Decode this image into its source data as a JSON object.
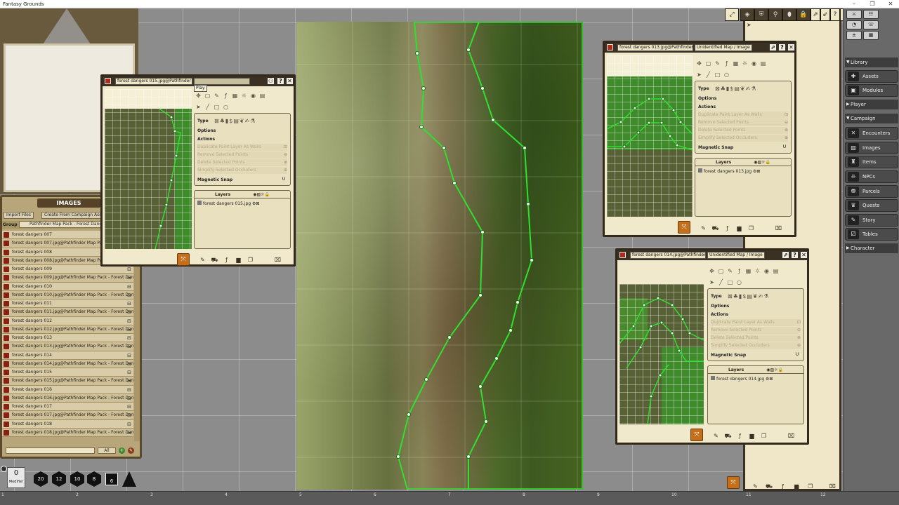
{
  "app": {
    "title": "Fantasy Grounds",
    "window_controls": [
      "–",
      "❐",
      "✕"
    ]
  },
  "images_panel": {
    "title": "IMAGES",
    "import_button": "Import Files",
    "create_button": "Create From Campaign Assets",
    "group_label": "Group",
    "group_value": "Pathfinder Map Pack - Forest Dangers.m",
    "filter_all": "All",
    "items": [
      "forest dangers 007",
      "forest dangers 007.jpg@Pathfinder Map Pack - Fo",
      "forest dangers 008",
      "forest dangers 008.jpg@Pathfinder Map Pack - Forest Dangers.m",
      "forest dangers 009",
      "forest dangers 009.jpg@Pathfinder Map Pack - Forest Dangers.m",
      "forest dangers 010",
      "forest dangers 010.jpg@Pathfinder Map Pack - Forest Dangers.m",
      "forest dangers 011",
      "forest dangers 011.jpg@Pathfinder Map Pack - Forest Dangers.m",
      "forest dangers 012",
      "forest dangers 012.jpg@Pathfinder Map Pack - Forest Dangers.m",
      "forest dangers 013",
      "forest dangers 013.jpg@Pathfinder Map Pack - Forest Dangers.m",
      "forest dangers 014",
      "forest dangers 014.jpg@Pathfinder Map Pack - Forest Dangers.m",
      "forest dangers 015",
      "forest dangers 015.jpg@Pathfinder Map Pack - Forest Dangers.m",
      "forest dangers 016",
      "forest dangers 016.jpg@Pathfinder Map Pack - Forest Dangers.m",
      "forest dangers 017",
      "forest dangers 017.jpg@Pathfinder Map Pack - Forest Dangers.m",
      "forest dangers 018",
      "forest dangers 018.jpg@Pathfinder Map Pack - Forest Dangers.m"
    ]
  },
  "windows": {
    "w15": {
      "tab1": "forest dangers 015.jpg@Pathfinder M",
      "tooltip": "Play",
      "layer": "forest dangers 015.jpg"
    },
    "w13": {
      "tab1": "forest dangers 013.jpg@Pathfinder M",
      "tab2": "Unidentified Map / Image",
      "layer": "forest dangers 013.jpg"
    },
    "w14": {
      "tab1": "forest dangers 014.jpg@Pathfinder M",
      "tab2": "Unidentified Map / Image",
      "layer": "forest dangers 014.jpg"
    }
  },
  "tools": {
    "type": "Type",
    "options": "Options",
    "actions": "Actions",
    "duplicate": "Duplicate Paint Layer As Walls",
    "remove": "Remove Selected Points",
    "delete": "Delete Selected Points",
    "simplify": "Simplify Selected Occluders",
    "magnetic": "Magnetic Snap",
    "layers": "Layers"
  },
  "sidebar": {
    "library": "Library",
    "assets": "Assets",
    "modules": "Modules",
    "player": "Player",
    "campaign": "Campaign",
    "encounters": "Encounters",
    "images": "Images",
    "items": "Items",
    "npcs": "NPCs",
    "parcels": "Parcels",
    "quests": "Quests",
    "story": "Story",
    "tables": "Tables",
    "character": "Character"
  },
  "hotbar": {
    "modifier_value": "0",
    "modifier_label": "Modifier",
    "dice": [
      "20",
      "12",
      "10",
      "8",
      "6",
      ""
    ]
  },
  "ruler": [
    "1",
    "2",
    "3",
    "4",
    "5",
    "6",
    "7",
    "8",
    "9",
    "10",
    "11",
    "12"
  ]
}
